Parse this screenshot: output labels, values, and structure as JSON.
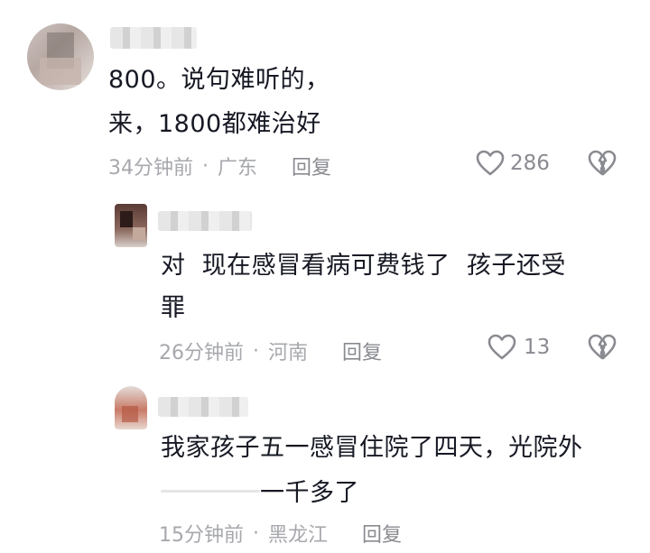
{
  "comments": [
    {
      "text_lines": [
        "800。说句难听的，",
        "来，1800都难治好"
      ],
      "time": "34分钟前",
      "location": "广东",
      "reply_label": "回复",
      "likes": "286",
      "like_icon": "heart-outline-icon",
      "dislike_icon": "broken-heart-icon"
    },
    {
      "text_lines": [
        "对  现在感冒看病可费钱了  孩子还受",
        "罪"
      ],
      "time": "26分钟前",
      "location": "河南",
      "reply_label": "回复",
      "likes": "13",
      "like_icon": "heart-outline-icon",
      "dislike_icon": "broken-heart-icon"
    },
    {
      "text_lines": [
        "我家孩子五一感冒住院了四天，光院外",
        "一千多了"
      ],
      "time": "15分钟前",
      "location": "黑龙江",
      "reply_label": "回复"
    }
  ],
  "meta_separator": "·",
  "colors": {
    "text": "#161823",
    "meta": "#a7a8ad",
    "action": "#8a8b91"
  }
}
